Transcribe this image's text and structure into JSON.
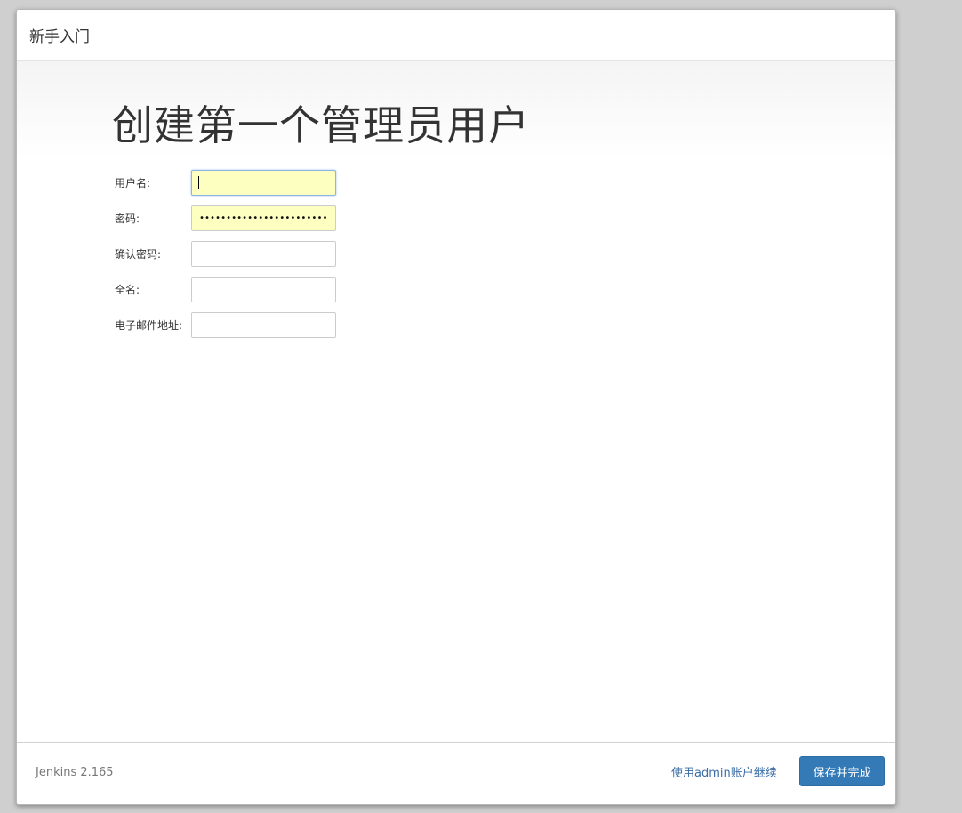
{
  "header": {
    "title": "新手入门"
  },
  "main": {
    "title": "创建第一个管理员用户",
    "fields": [
      {
        "label": "用户名:",
        "value": "",
        "autofill": true,
        "focused": true
      },
      {
        "label": "密码:",
        "value": "••••••••••••••••••••••••••••••••••••",
        "autofill": true,
        "focused": false
      },
      {
        "label": "确认密码:",
        "value": "",
        "autofill": false,
        "focused": false
      },
      {
        "label": "全名:",
        "value": "",
        "autofill": false,
        "focused": false
      },
      {
        "label": "电子邮件地址:",
        "value": "",
        "autofill": false,
        "focused": false
      }
    ]
  },
  "footer": {
    "version": "Jenkins 2.165",
    "continue_link": "使用admin账户继续",
    "save_button": "保存并完成"
  },
  "colors": {
    "autofill_bg": "#fcffc0",
    "primary_button": "#337ab7",
    "link": "#3a6ea5"
  }
}
